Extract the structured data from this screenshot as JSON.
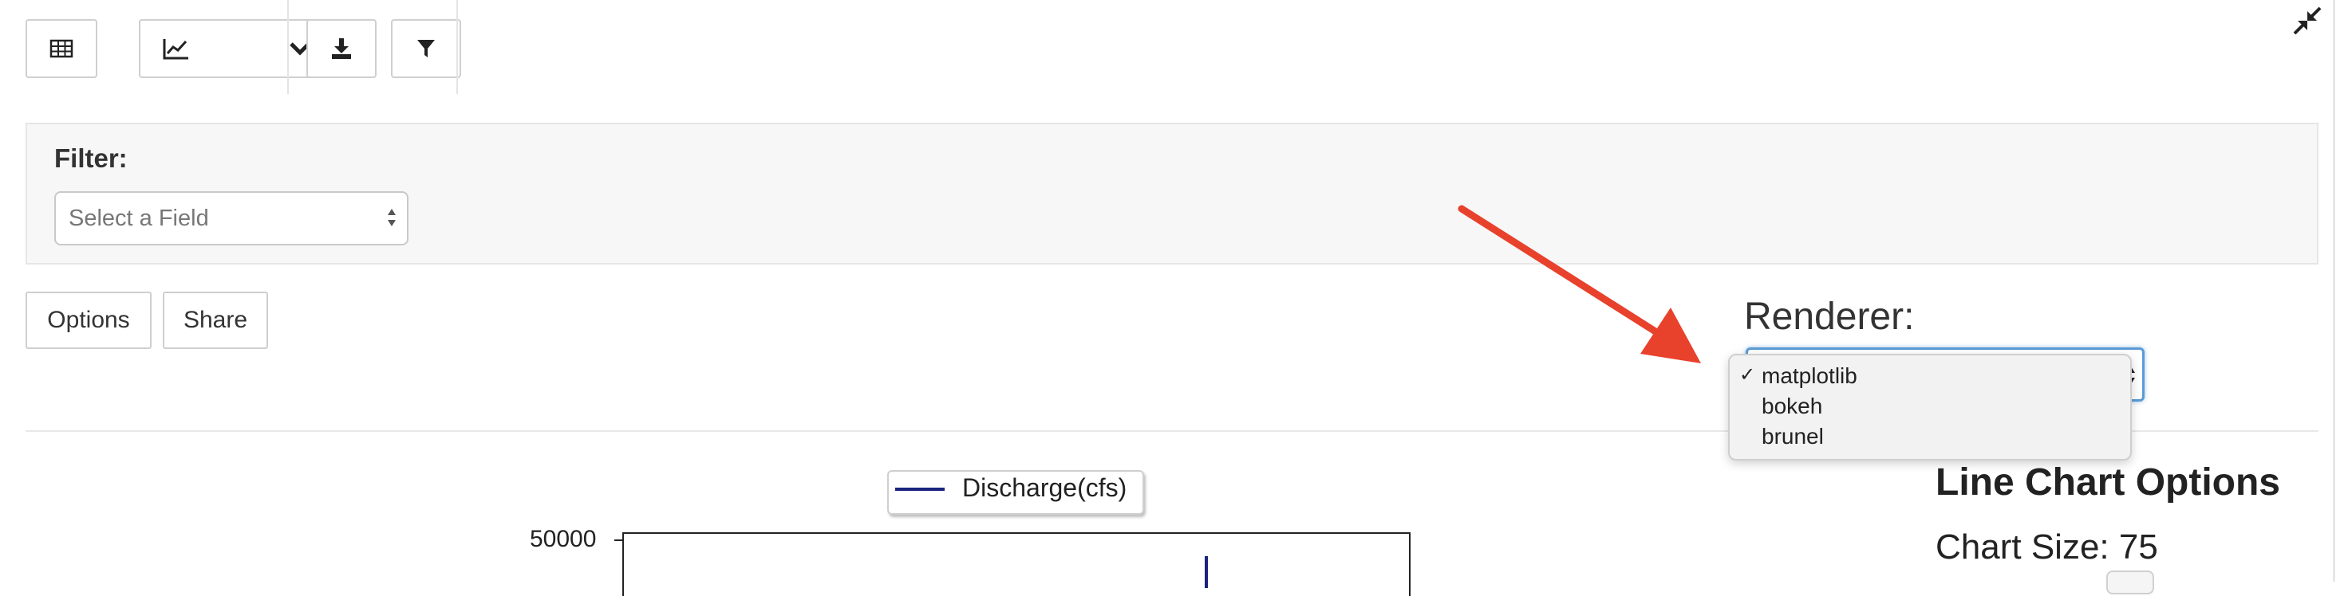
{
  "toolbar": {
    "table_icon": "table-icon",
    "chart_icon": "line-chart-icon",
    "chevron_icon": "chevron-down-icon",
    "download_icon": "download-icon",
    "filter_icon": "filter-icon"
  },
  "filter": {
    "label": "Filter:",
    "placeholder": "Select a Field"
  },
  "actions": {
    "options_label": "Options",
    "share_label": "Share"
  },
  "renderer": {
    "label": "Renderer:",
    "options": [
      "matplotlib",
      "bokeh",
      "brunel"
    ],
    "selected": "matplotlib"
  },
  "chart": {
    "legend": "Discharge(cfs)",
    "y_tick": "50000",
    "series_color": "#1a237e"
  },
  "line_chart_options": {
    "title": "Line Chart Options",
    "chart_size": "Chart Size: 75"
  },
  "colors": {
    "annotation_arrow": "#e8412c",
    "focus_border": "#5b9bd5"
  }
}
